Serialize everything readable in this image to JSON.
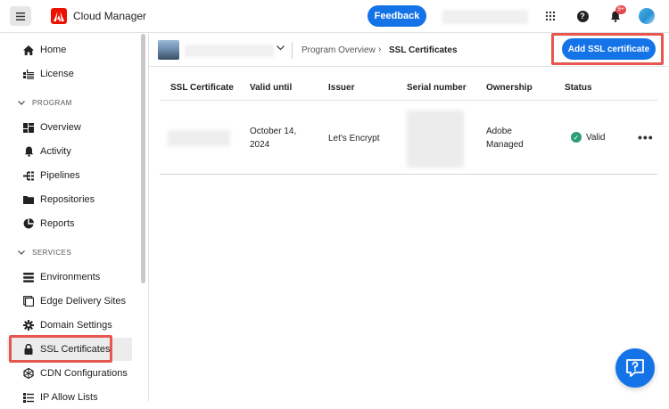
{
  "header": {
    "menu_icon": "hamburger-icon",
    "app_title": "Cloud Manager",
    "feedback_label": "Feedback",
    "notification_count": "9+"
  },
  "sidebar": {
    "items_top": [
      {
        "label": "Home",
        "icon": "home-icon"
      },
      {
        "label": "License",
        "icon": "license-icon"
      }
    ],
    "program_section": "PROGRAM",
    "program_items": [
      {
        "label": "Overview",
        "icon": "overview-icon"
      },
      {
        "label": "Activity",
        "icon": "bell-icon"
      },
      {
        "label": "Pipelines",
        "icon": "pipeline-icon"
      },
      {
        "label": "Repositories",
        "icon": "folder-icon"
      },
      {
        "label": "Reports",
        "icon": "pie-chart-icon"
      }
    ],
    "services_section": "SERVICES",
    "services_items": [
      {
        "label": "Environments",
        "icon": "environments-icon"
      },
      {
        "label": "Edge Delivery Sites",
        "icon": "edge-icon"
      },
      {
        "label": "Domain Settings",
        "icon": "gear-icon"
      },
      {
        "label": "SSL Certificates",
        "icon": "lock-icon"
      },
      {
        "label": "CDN Configurations",
        "icon": "cdn-icon"
      },
      {
        "label": "IP Allow Lists",
        "icon": "ip-list-icon"
      }
    ]
  },
  "breadcrumb": {
    "parent": "Program Overview",
    "separator": "›",
    "current": "SSL Certificates"
  },
  "actions": {
    "add_ssl_label": "Add SSL certificate"
  },
  "table": {
    "columns": [
      "SSL Certificate",
      "Valid until",
      "Issuer",
      "Serial number",
      "Ownership",
      "Status"
    ],
    "rows": [
      {
        "valid_until_line1": "October 14,",
        "valid_until_line2": "2024",
        "issuer": "Let's Encrypt",
        "ownership_line1": "Adobe",
        "ownership_line2": "Managed",
        "status": "Valid"
      }
    ]
  },
  "colors": {
    "primary": "#1473e6",
    "highlight": "#e8574f",
    "valid": "#2d9d78"
  }
}
